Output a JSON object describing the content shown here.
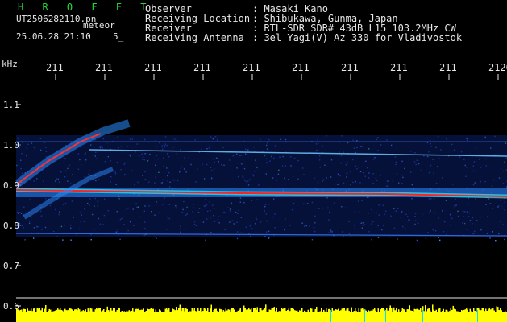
{
  "header": {
    "brand": "H R O F F T",
    "filename": "UT2506282110.pn",
    "filename_suffix": "meteor",
    "timestamp": "25.06.28 21:10",
    "timestamp_extra": "5_"
  },
  "info": [
    {
      "label": "Observer",
      "value": ": Masaki Kano"
    },
    {
      "label": "Receiving Location",
      "value": ": Shibukawa, Gunma, Japan"
    },
    {
      "label": "Receiver",
      "value": ": RTL-SDR SDR# 43dB L15 103.2MHz CW"
    },
    {
      "label": "Receiving Antenna",
      "value": ": 3el Yagi(V) Az 330 for Vladivostok"
    }
  ],
  "axis": {
    "unit_label": "kHz",
    "time_ticks": [
      "211",
      "211",
      "211",
      "211",
      "211",
      "211",
      "211",
      "211",
      "211",
      "2120"
    ],
    "freq_labels": [
      "1.1",
      "1.0",
      "0.9",
      "0.8",
      "0.7",
      "0.6"
    ]
  },
  "colors": {
    "text": "#e8e8e8",
    "brand": "#1fdc3a",
    "carrier": "#ff2020",
    "noise": "#1a5cff",
    "power": "#ffff00",
    "cursor": "#00e5ff"
  }
}
